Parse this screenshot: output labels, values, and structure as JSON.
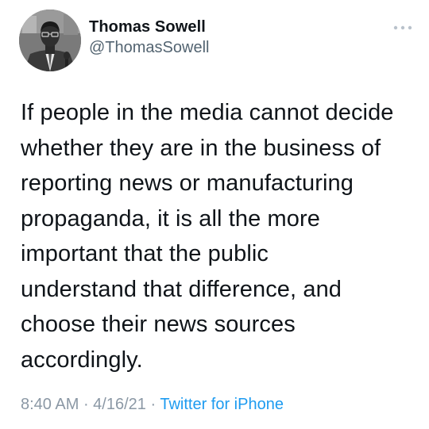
{
  "author": {
    "display_name": "Thomas Sowell",
    "handle": "@ThomasSowell"
  },
  "icons": {
    "more": "more-options-icon",
    "avatar": "profile-photo"
  },
  "tweet": {
    "text": "If people in the media cannot decide\nwhether they are in the business of\nreporting news or manufacturing\npropaganda, it is all the more\nimportant that the public\nunderstand that difference, and\nchoose their news sources\naccordingly."
  },
  "meta": {
    "time": "8:40 AM",
    "separator_1": " · ",
    "date": "4/16/21",
    "separator_2": " · ",
    "source": "Twitter for iPhone"
  },
  "colors": {
    "text": "#0f1419",
    "secondary": "#536471",
    "timestamp": "#8b98a5",
    "link": "#1d9bf0"
  }
}
